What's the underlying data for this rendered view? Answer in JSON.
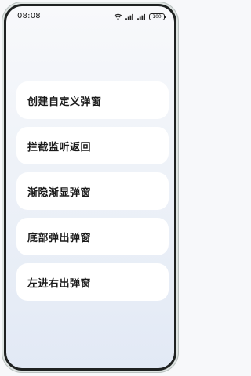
{
  "status_bar": {
    "time": "08:08",
    "battery_label": "100",
    "icons": [
      "wifi-icon",
      "signal-icon",
      "signal-icon",
      "battery-icon"
    ]
  },
  "menu": {
    "items": [
      {
        "label": "创建自定义弹窗"
      },
      {
        "label": "拦截监听返回"
      },
      {
        "label": "渐隐渐显弹窗"
      },
      {
        "label": "底部弹出弹窗"
      },
      {
        "label": "左进右出弹窗"
      }
    ]
  },
  "colors": {
    "card_background": "#ffffff",
    "text": "#1a1a1a",
    "gradient_top": "#f8f9fb",
    "gradient_bottom": "#e2e9f5",
    "frame": "#1f2222"
  }
}
